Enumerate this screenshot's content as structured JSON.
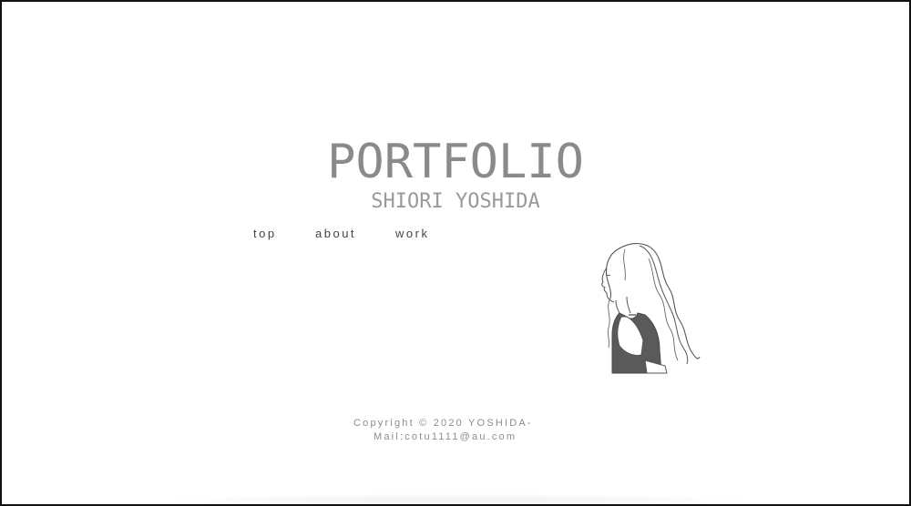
{
  "header": {
    "title": "PORTFOLIO",
    "subtitle": "SHIORI YOSHIDA"
  },
  "nav": {
    "items": [
      {
        "label": "top"
      },
      {
        "label": "about"
      },
      {
        "label": "work"
      }
    ]
  },
  "illustration": {
    "icon": "girl-profile-line-illustration-icon"
  },
  "footer": {
    "copyright": "Copyright © 2020 YOSHIDA-",
    "mail": "Mail:cotu1111@au.com"
  },
  "colors": {
    "title": "#8a8a8a",
    "nav_text": "#444444",
    "footer_text": "#8c8c8c",
    "border": "#111111",
    "background": "#ffffff"
  }
}
